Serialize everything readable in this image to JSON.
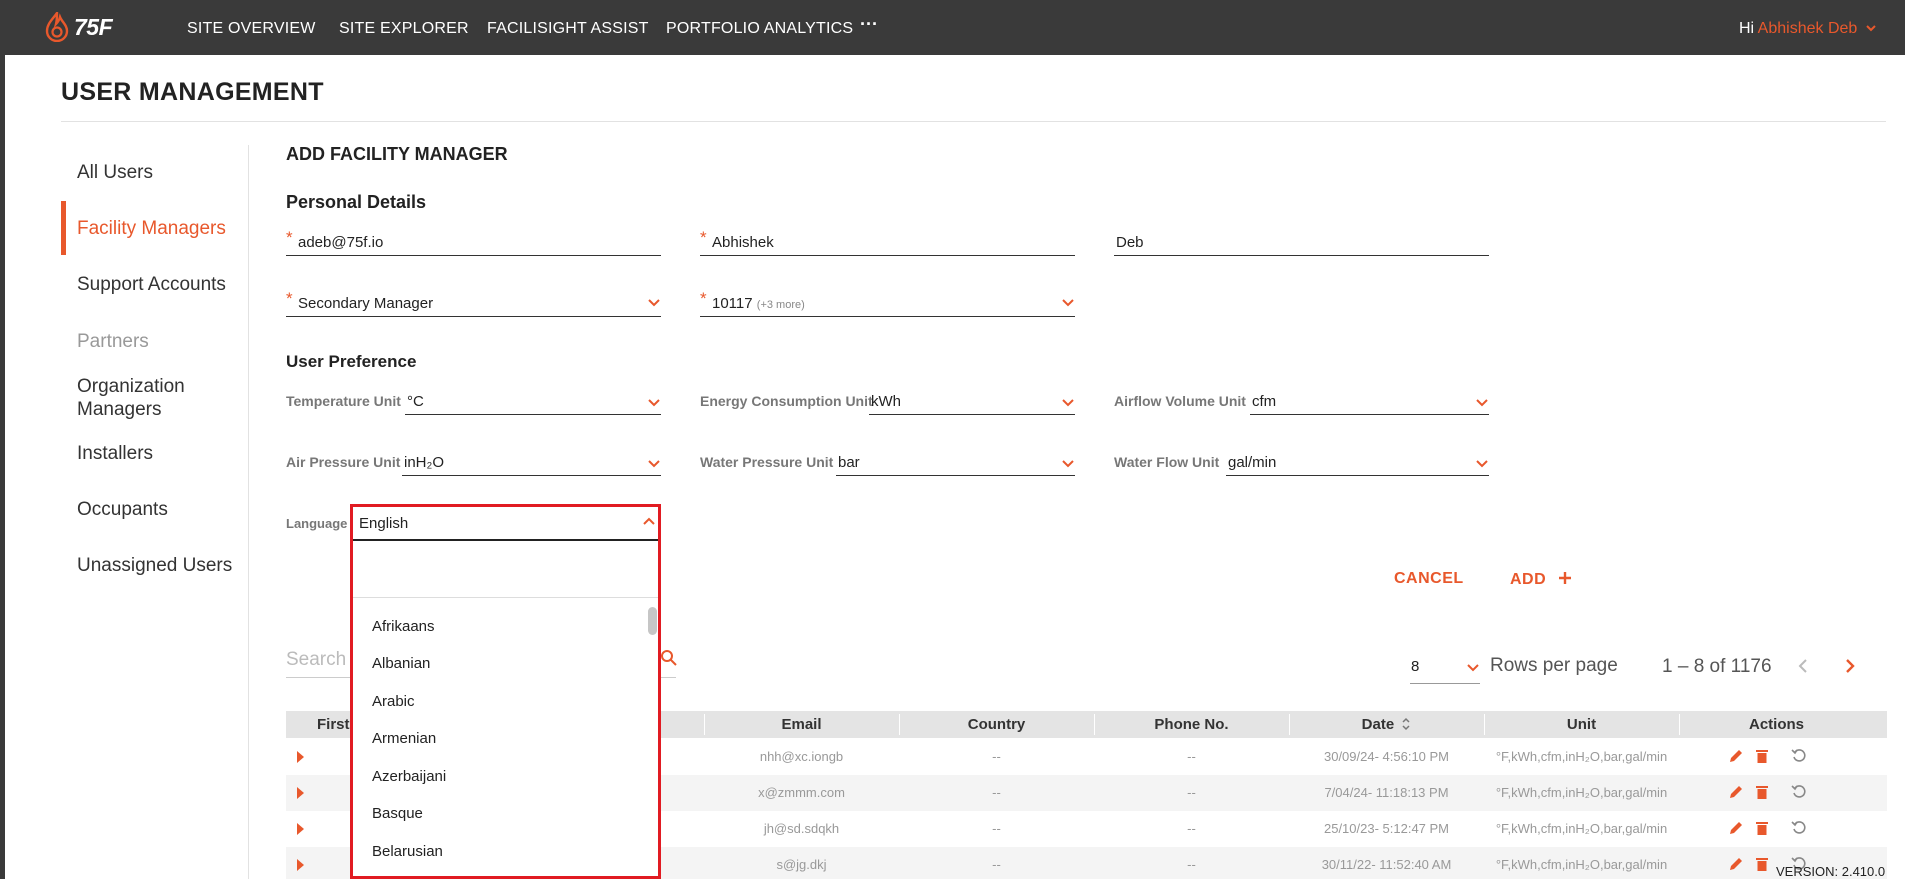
{
  "nav": {
    "logo_text": "75F",
    "items": [
      "SITE OVERVIEW",
      "SITE EXPLORER",
      "FACILISIGHT ASSIST",
      "PORTFOLIO ANALYTICS"
    ],
    "more": "···",
    "greeting": "Hi",
    "user": "Abhishek Deb"
  },
  "page_title": "USER MANAGEMENT",
  "sidebar": {
    "items": [
      {
        "label": "All Users"
      },
      {
        "label": "Facility Managers",
        "active": true
      },
      {
        "label": "Support Accounts"
      },
      {
        "label": "Partners",
        "disabled": true
      },
      {
        "label": "Organization Managers"
      },
      {
        "label": "Installers"
      },
      {
        "label": "Occupants"
      },
      {
        "label": "Unassigned Users"
      }
    ]
  },
  "form": {
    "title": "ADD FACILITY MANAGER",
    "personal_heading": "Personal Details",
    "email": "adeb@75f.io",
    "first_name": "Abhishek",
    "last_name": "Deb",
    "role": "Secondary Manager",
    "site": "10117",
    "site_more": "(+3 more)",
    "pref_heading": "User Preference",
    "prefs": {
      "temperature": {
        "label": "Temperature Unit",
        "value": "°C"
      },
      "energy": {
        "label": "Energy Consumption Unit",
        "value": "kWh"
      },
      "airflow": {
        "label": "Airflow Volume Unit",
        "value": "cfm"
      },
      "air_pressure": {
        "label": "Air Pressure Unit",
        "value": "inH₂O"
      },
      "water_pressure": {
        "label": "Water Pressure Unit",
        "value": "bar"
      },
      "water_flow": {
        "label": "Water Flow Unit",
        "value": "gal/min"
      }
    },
    "language_label": "Language",
    "language": "English",
    "cancel": "CANCEL",
    "add": "ADD"
  },
  "language_options": [
    "Afrikaans",
    "Albanian",
    "Arabic",
    "Armenian",
    "Azerbaijani",
    "Basque",
    "Belarusian"
  ],
  "table": {
    "search_placeholder": "Search",
    "rows_per_page_value": "8",
    "rows_per_page_label": "Rows per page",
    "range": "1 – 8 of 1176",
    "columns": [
      "First",
      "Email",
      "Country",
      "Phone No.",
      "Date",
      "Unit",
      "Actions"
    ],
    "rows": [
      {
        "email": "nhh@xc.iongb",
        "country": "--",
        "phone": "--",
        "date": "30/09/24- 4:56:10 PM",
        "unit": "°F,kWh,cfm,inH₂O,bar,gal/min"
      },
      {
        "email": "x@zmmm.com",
        "country": "--",
        "phone": "--",
        "date": "7/04/24- 11:18:13 PM",
        "unit": "°F,kWh,cfm,inH₂O,bar,gal/min"
      },
      {
        "email": "jh@sd.sdqkh",
        "country": "--",
        "phone": "--",
        "date": "25/10/23- 5:12:47 PM",
        "unit": "°F,kWh,cfm,inH₂O,bar,gal/min"
      },
      {
        "email": "s@jg.dkj",
        "country": "--",
        "phone": "--",
        "date": "30/11/22- 11:52:40 AM",
        "unit": "°F,kWh,cfm,inH₂O,bar,gal/min"
      }
    ]
  },
  "version": "VERSION: 2.410.0",
  "colors": {
    "accent": "#e8582c",
    "topbar": "#3a3a3a",
    "highlight": "#e11b22"
  }
}
